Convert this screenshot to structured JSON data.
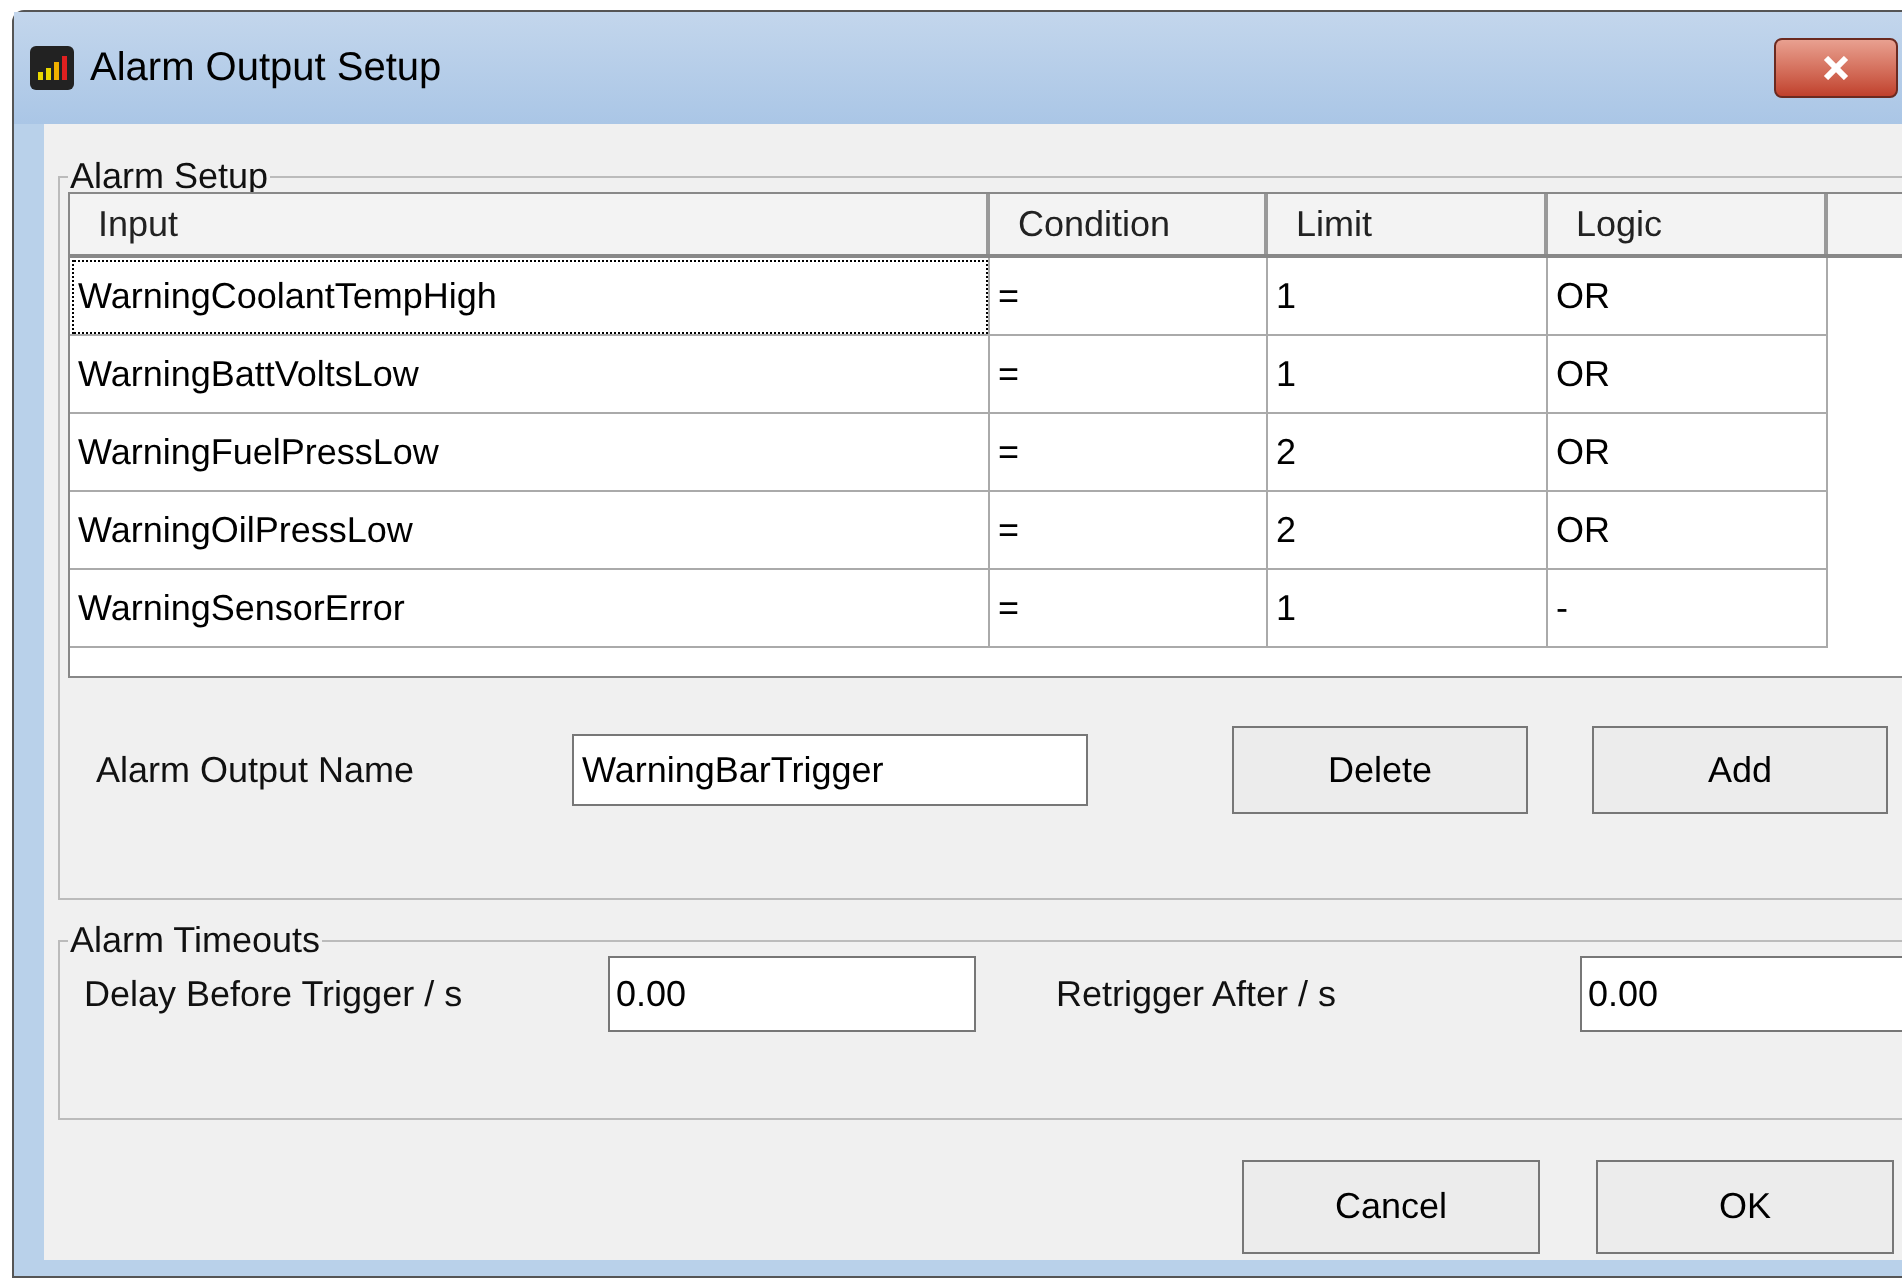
{
  "window": {
    "title": "Alarm Output Setup"
  },
  "alarm_setup": {
    "title": "Alarm Setup",
    "columns": [
      "Input",
      "Condition",
      "Limit",
      "Logic"
    ],
    "rows": [
      {
        "cells": [
          "WarningCoolantTempHigh",
          "=",
          "1",
          "OR"
        ],
        "selected": true
      },
      {
        "cells": [
          "WarningBattVoltsLow",
          "=",
          "1",
          "OR"
        ],
        "selected": false
      },
      {
        "cells": [
          "WarningFuelPressLow",
          "=",
          "2",
          "OR"
        ],
        "selected": false
      },
      {
        "cells": [
          "WarningOilPressLow",
          "=",
          "2",
          "OR"
        ],
        "selected": false
      },
      {
        "cells": [
          "WarningSensorError",
          "=",
          "1",
          "-"
        ],
        "selected": false
      }
    ],
    "name_label": "Alarm Output Name",
    "name_value": "WarningBarTrigger",
    "buttons": [
      "Delete",
      "Add"
    ]
  },
  "alarm_timeouts": {
    "title": "Alarm Timeouts",
    "fields": [
      {
        "label": "Delay Before Trigger / s",
        "value": "0.00"
      },
      {
        "label": "Retrigger After / s",
        "value": "0.00"
      }
    ]
  },
  "buttons": [
    "Cancel",
    "OK"
  ]
}
